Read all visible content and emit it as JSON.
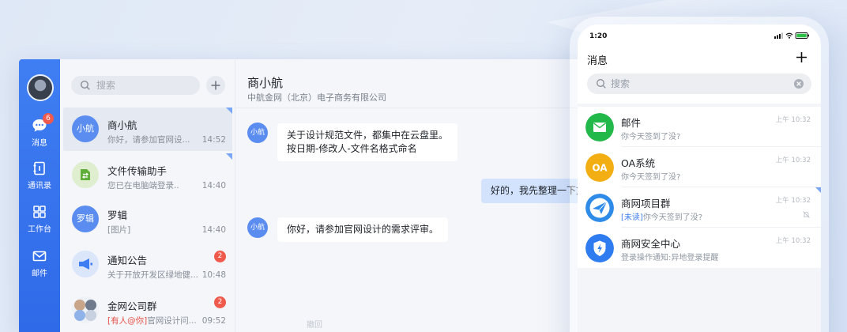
{
  "desktop": {
    "rail": {
      "items": [
        {
          "label": "消息",
          "badge": "6"
        },
        {
          "label": "通讯录"
        },
        {
          "label": "工作台"
        },
        {
          "label": "邮件"
        }
      ]
    },
    "list": {
      "search_placeholder": "搜索",
      "conversations": [
        {
          "avatar_text": "小航",
          "name": "商小航",
          "preview": "你好，请参加官网设...",
          "time": "14:52",
          "active": true,
          "pinned": true,
          "avatar_color": "#5b8df0"
        },
        {
          "avatar_text": "",
          "name": "文件传输助手",
          "preview": "您已在电脑端登录..",
          "time": "14:40",
          "pinned": true,
          "avatar_icon": "file-transfer-icon",
          "avatar_color": "#dfeecf"
        },
        {
          "avatar_text": "罗辑",
          "name": "罗辑",
          "preview": "[图片]",
          "time": "14:40",
          "avatar_color": "#5b8df0"
        },
        {
          "avatar_text": "",
          "name": "通知公告",
          "preview": "关于开放开发区绿地健...",
          "time": "10:48",
          "badge": "2",
          "avatar_icon": "megaphone-icon",
          "avatar_color": "#dbe6fb"
        },
        {
          "avatar_text": "",
          "name": "金网公司群",
          "mention": "[有人@你]",
          "preview": "官网设计问...",
          "time": "09:52",
          "badge": "2",
          "avatar_icon": "group-avatar-icon"
        }
      ]
    },
    "chat": {
      "title": "商小航",
      "subtitle": "中航金网（北京）电子商务有限公司",
      "messages": [
        {
          "from": "other",
          "avatar_text": "小航",
          "lines": [
            "关于设计规范文件，都集中在云盘里。",
            "按日期-修改人-文件名格式命名"
          ]
        },
        {
          "from": "me",
          "lines": [
            "好的，我先整理一下文件"
          ]
        },
        {
          "from": "other",
          "avatar_text": "小航",
          "lines": [
            "你好，请参加官网设计的需求评审。"
          ]
        }
      ],
      "faint_text": "撤回"
    }
  },
  "phone": {
    "status_time": "1:20",
    "title": "消息",
    "search_placeholder": "搜索",
    "items": [
      {
        "name": "邮件",
        "preview": "你今天签到了没?",
        "time": "上午 10:32",
        "icon": "mail-icon",
        "color": "#22b84a"
      },
      {
        "name": "OA系统",
        "preview": "你今天签到了没?",
        "time": "上午 10:32",
        "icon": "oa-icon",
        "icon_text": "OA",
        "color": "#f2ae13"
      },
      {
        "name": "商网项目群",
        "unread": "[未读]",
        "preview": "你今天签到了没?",
        "time": "上午 10:32",
        "icon": "paper-plane-icon",
        "color": "#2e8be8",
        "pinned": true,
        "muted": true
      },
      {
        "name": "商网安全中心",
        "preview": "登录操作通知:异地登录提醒",
        "time": "上午 10:32",
        "icon": "shield-bolt-icon",
        "color": "#2f7cf0"
      }
    ]
  }
}
